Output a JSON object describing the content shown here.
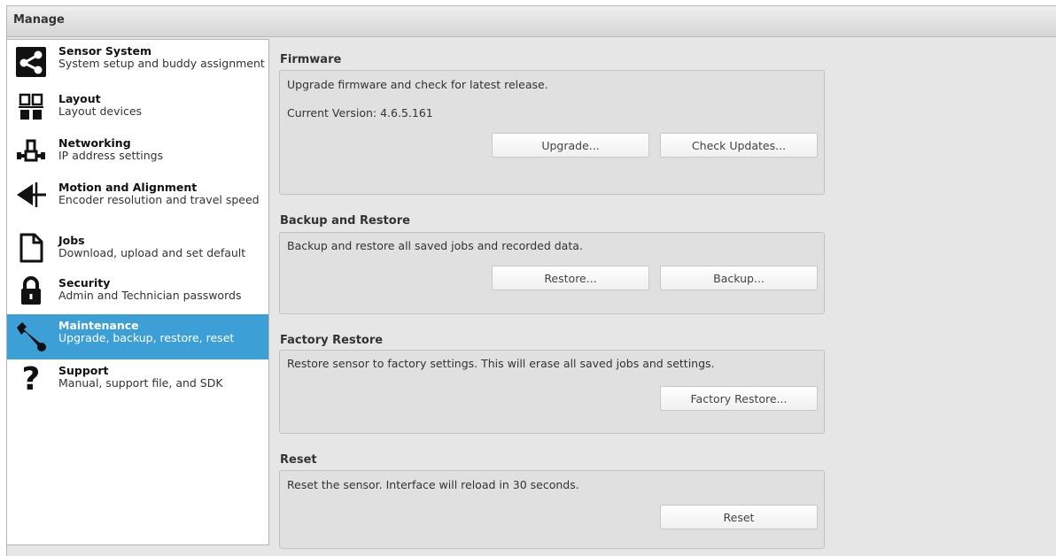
{
  "window": {
    "title": "Manage"
  },
  "sidebar": {
    "items": [
      {
        "title": "Sensor System",
        "desc": "System setup and buddy assignment",
        "icon": "share-nodes-icon",
        "active": false
      },
      {
        "title": "Layout",
        "desc": "Layout devices",
        "icon": "layout-blocks-icon",
        "active": false
      },
      {
        "title": "Networking",
        "desc": "IP address settings",
        "icon": "network-icon",
        "active": false
      },
      {
        "title": "Motion and Alignment",
        "desc": "Encoder resolution and travel speed",
        "icon": "arrow-left-axis-icon",
        "active": false
      },
      {
        "title": "Jobs",
        "desc": "Download, upload and set default",
        "icon": "document-icon",
        "active": false
      },
      {
        "title": "Security",
        "desc": "Admin and Technician passwords",
        "icon": "lock-icon",
        "active": false
      },
      {
        "title": "Maintenance",
        "desc": "Upgrade, backup, restore, reset",
        "icon": "wrench-icon",
        "active": true
      },
      {
        "title": "Support",
        "desc": "Manual, support file, and SDK",
        "icon": "question-mark-icon",
        "active": false
      }
    ]
  },
  "firmware": {
    "title": "Firmware",
    "description": "Upgrade firmware and check for latest release.",
    "version_label": "Current Version:",
    "version_value": "4.6.5.161",
    "upgrade_label": "Upgrade...",
    "check_updates_label": "Check Updates..."
  },
  "backup": {
    "title": "Backup and Restore",
    "description": "Backup and restore all saved jobs and recorded data.",
    "restore_label": "Restore...",
    "backup_label": "Backup..."
  },
  "factory": {
    "title": "Factory Restore",
    "description": "Restore sensor to factory settings. This will erase all saved jobs and settings.",
    "button_label": "Factory Restore..."
  },
  "reset": {
    "title": "Reset",
    "description": "Reset the sensor. Interface will reload in 30 seconds.",
    "button_label": "Reset"
  }
}
